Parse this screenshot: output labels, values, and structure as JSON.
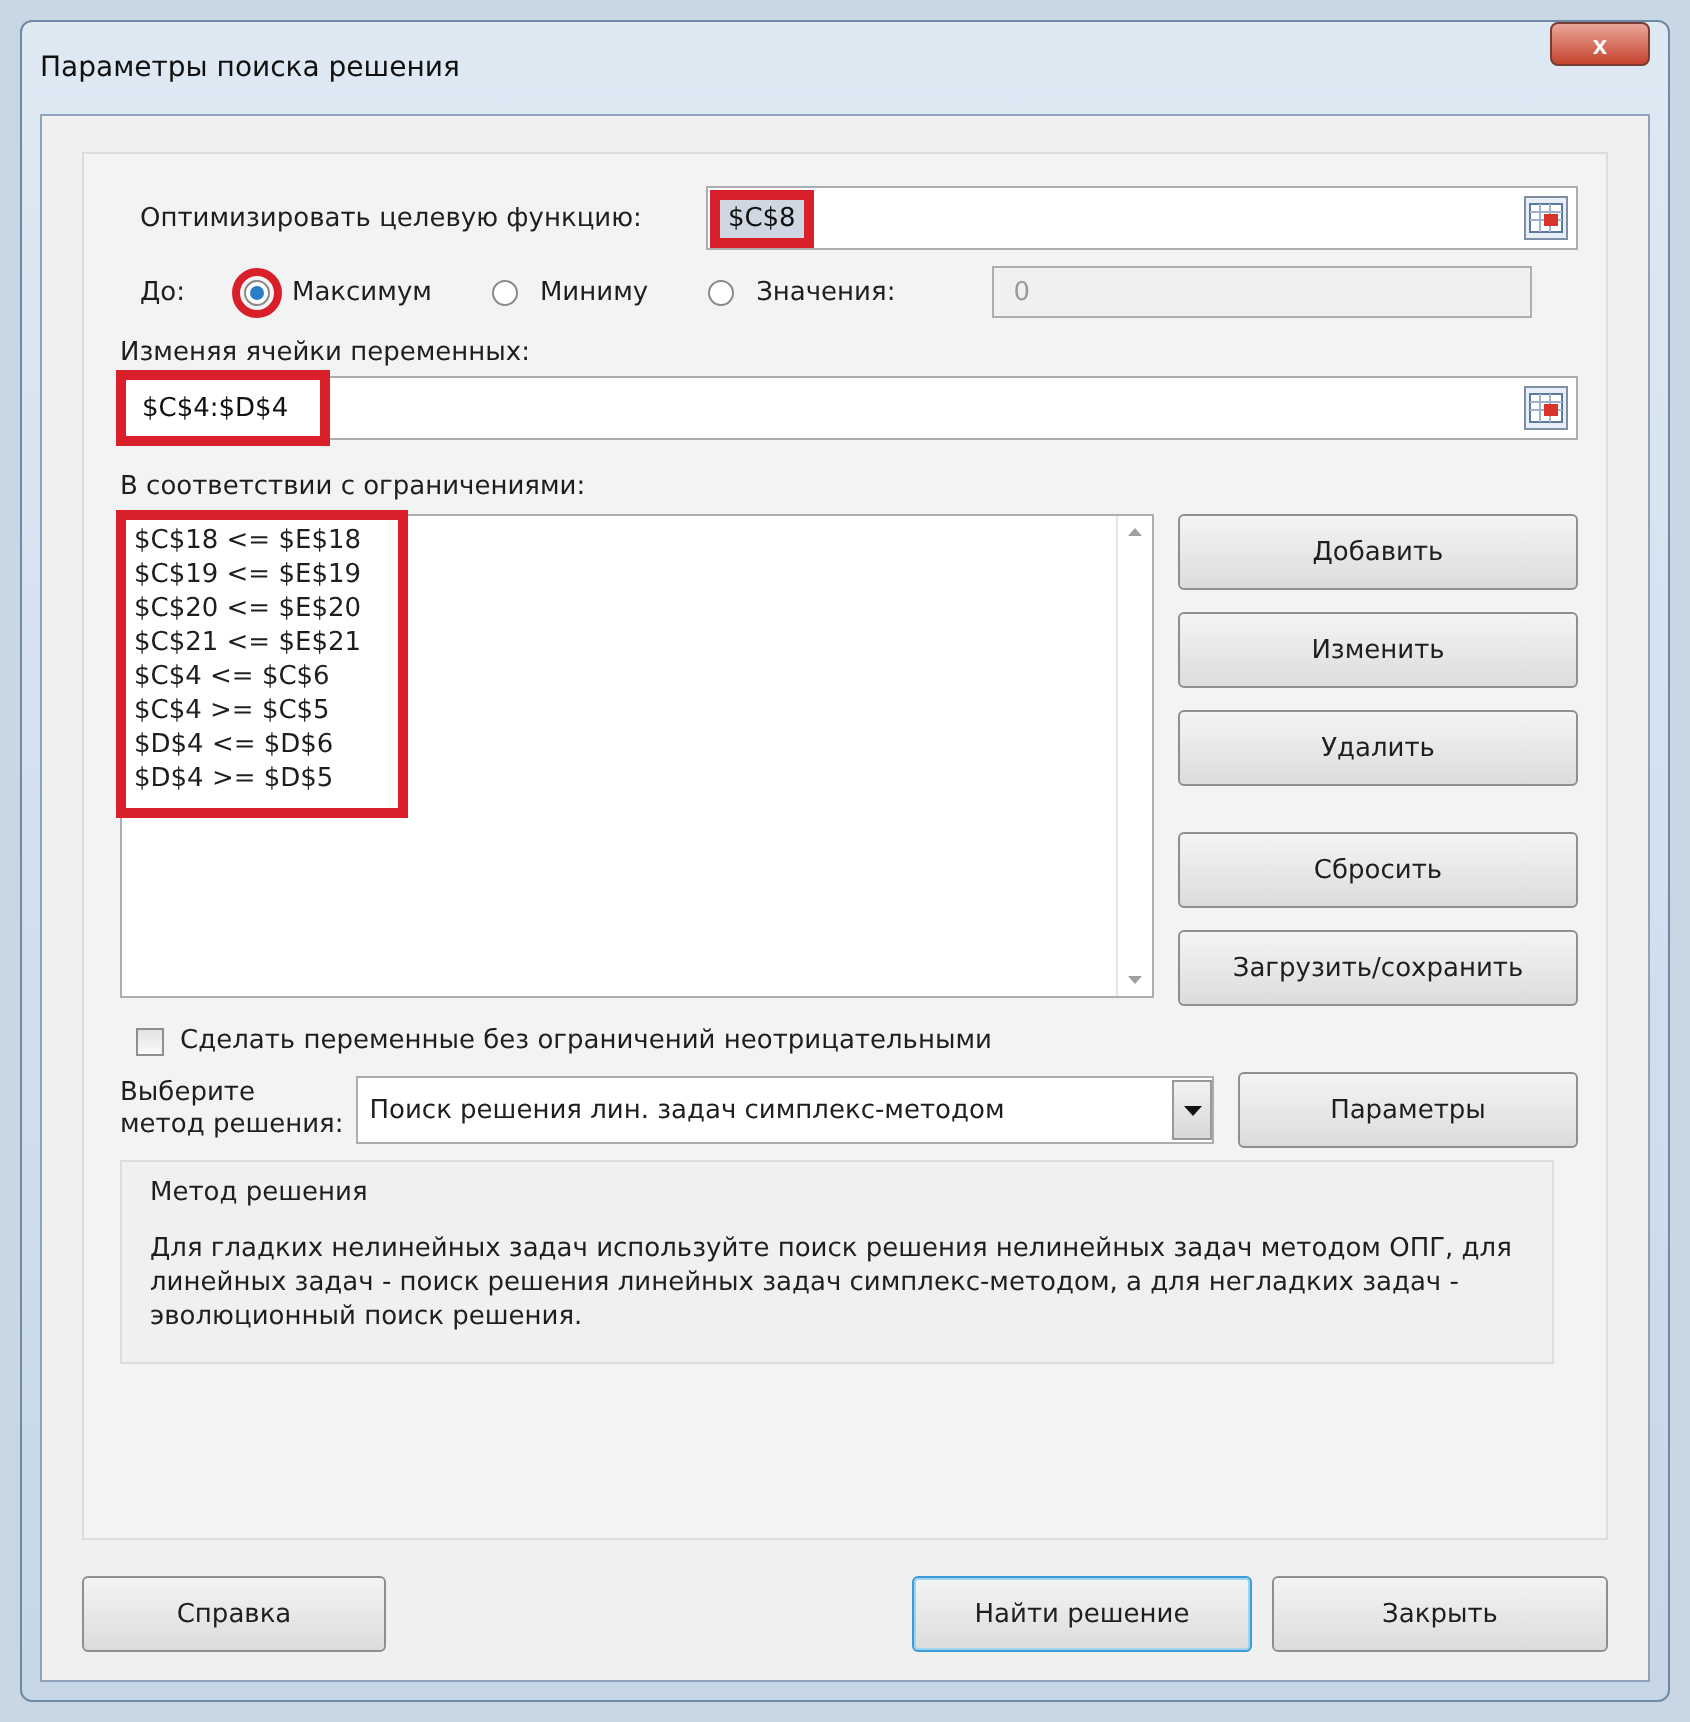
{
  "window": {
    "title": "Параметры поиска решения",
    "close": "x"
  },
  "objective": {
    "label": "Оптимизировать целевую функцию:",
    "value": "$C$8",
    "highlighted": true
  },
  "to": {
    "label": "До:",
    "options": [
      {
        "label": "Максимум",
        "selected": true,
        "highlighted": true
      },
      {
        "label": "Миниму",
        "selected": false,
        "highlighted": false
      },
      {
        "label": "Значения:",
        "selected": false,
        "highlighted": false
      }
    ],
    "value_field": {
      "value": "0",
      "disabled": true
    }
  },
  "variables": {
    "label": "Изменяя ячейки переменных:",
    "value": "$C$4:$D$4",
    "highlighted": true
  },
  "constraints": {
    "label": "В соответствии с ограничениями:",
    "highlighted": true,
    "items": [
      "$C$18 <= $E$18",
      "$C$19 <= $E$19",
      "$C$20 <= $E$20",
      "$C$21 <= $E$21",
      "$C$4 <= $C$6",
      "$C$4 >= $C$5",
      "$D$4 <= $D$6",
      "$D$4 >= $D$5"
    ]
  },
  "side_buttons": [
    "Добавить",
    "Изменить",
    "Удалить",
    "Сбросить",
    "Загрузить/сохранить"
  ],
  "nonnegative": {
    "label": "Сделать переменные без ограничений неотрицательными",
    "checked": false
  },
  "method": {
    "label_line1": "Выберите",
    "label_line2": "метод решения:",
    "value": "Поиск решения лин. задач симплекс-методом",
    "button": "Параметры"
  },
  "method_group": {
    "title": "Метод решения",
    "text": "Для гладких нелинейных задач используйте поиск решения нелинейных задач методом ОПГ, для линейных задач - поиск решения линейных задач симплекс-методом, а для негладких задач - эволюционный поиск решения."
  },
  "footer": [
    {
      "label": "Справка",
      "default": false
    },
    {
      "label": "Найти решение",
      "default": true
    },
    {
      "label": "Закрыть",
      "default": false
    }
  ]
}
